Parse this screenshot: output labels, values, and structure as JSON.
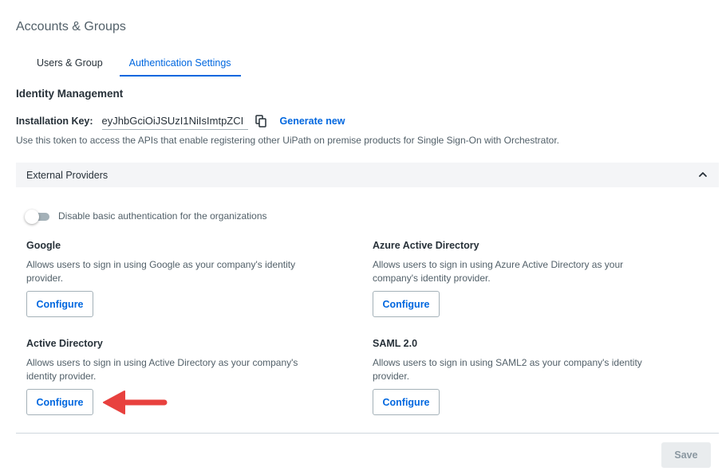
{
  "page": {
    "title": "Accounts & Groups"
  },
  "tabs": [
    {
      "label": "Users & Group",
      "active": false
    },
    {
      "label": "Authentication Settings",
      "active": true
    }
  ],
  "identity": {
    "heading": "Identity Management",
    "key_label": "Installation Key:",
    "key_value": "eyJhbGciOiJSUzI1NiIsImtpZCI",
    "copy_icon": "copy-icon",
    "generate_label": "Generate new",
    "help_text": "Use this token to access the APIs that enable registering other UiPath on premise products for Single Sign-On with Orchestrator."
  },
  "external_providers": {
    "title": "External Providers",
    "expanded": true,
    "toggle_label": "Disable basic authentication for the organizations",
    "toggle_on": false,
    "providers": [
      {
        "name": "Google",
        "description": "Allows users to sign in using Google as your company's identity provider.",
        "button": "Configure"
      },
      {
        "name": "Azure Active Directory",
        "description": "Allows users to sign in using Azure Active Directory as your company's identity provider.",
        "button": "Configure"
      },
      {
        "name": "Active Directory",
        "description": "Allows users to sign in using Active Directory as your company's identity provider.",
        "button": "Configure"
      },
      {
        "name": "SAML 2.0",
        "description": "Allows users to sign in using SAML2 as your company's identity provider.",
        "button": "Configure"
      }
    ]
  },
  "footer": {
    "save_label": "Save",
    "save_enabled": false
  },
  "colors": {
    "accent": "#0067df",
    "annotation_arrow": "#e8413e",
    "panel_bg": "#f4f5f7"
  }
}
